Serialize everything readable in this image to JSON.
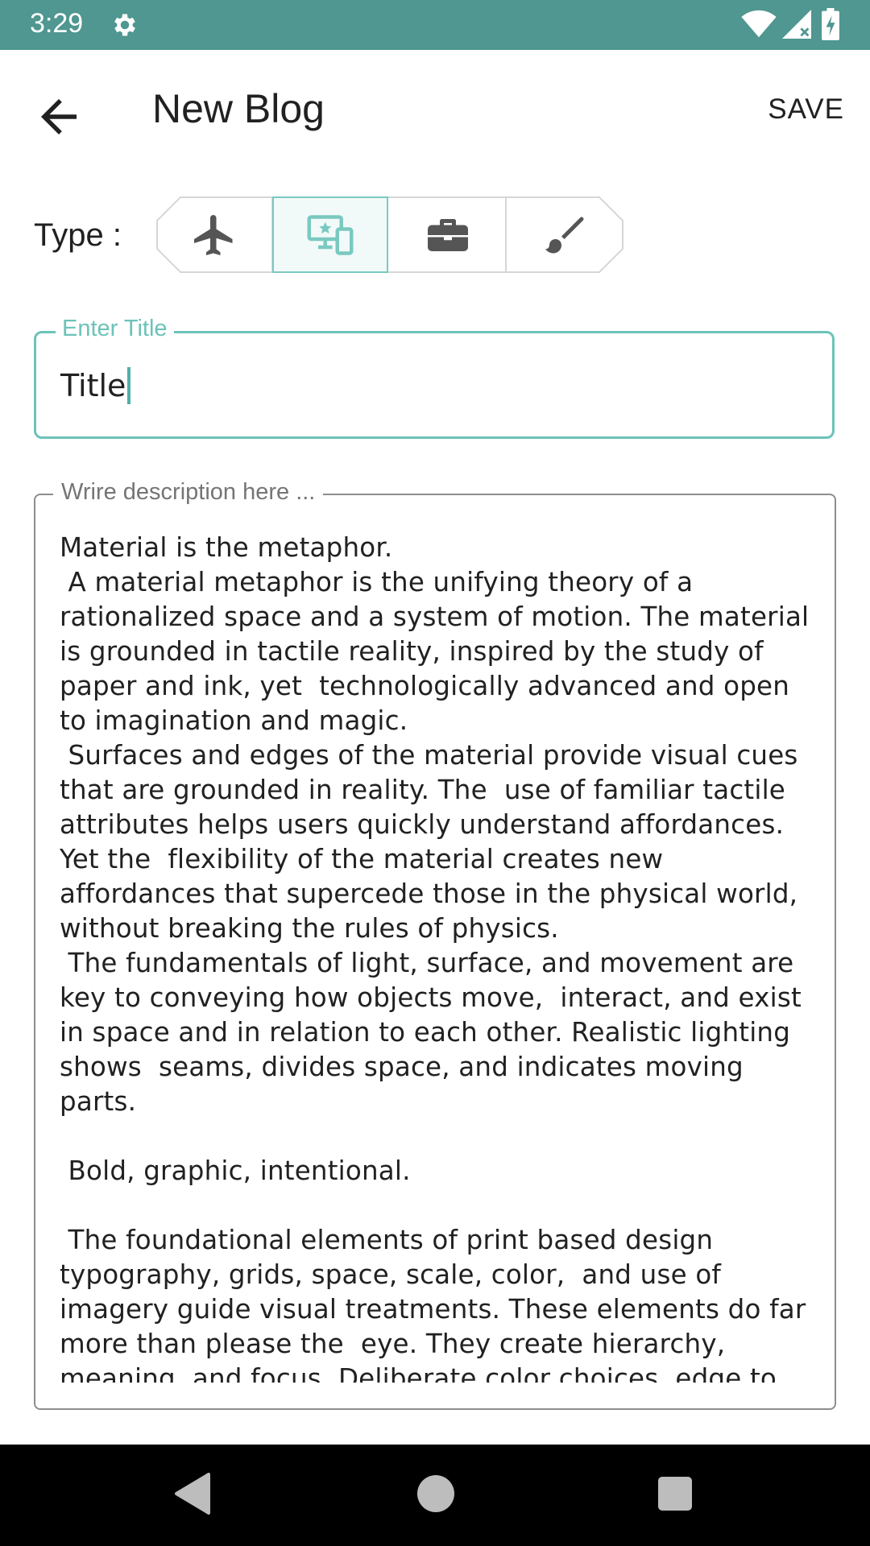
{
  "status_bar": {
    "time": "3:29",
    "icons": [
      "gear-icon",
      "wifi-icon",
      "signal-icon",
      "battery-icon"
    ]
  },
  "app_bar": {
    "back_icon": "arrow-left-icon",
    "title": "New Blog",
    "save_label": "SAVE"
  },
  "type_selector": {
    "label": "Type :",
    "options": [
      {
        "icon": "airplane-icon",
        "selected": false
      },
      {
        "icon": "devices-icon",
        "selected": true
      },
      {
        "icon": "briefcase-icon",
        "selected": false
      },
      {
        "icon": "brush-icon",
        "selected": false
      }
    ]
  },
  "title_field": {
    "label": "Enter Title",
    "value": "Title"
  },
  "description_field": {
    "label": "Wrire description here ...",
    "value": "Material is the metaphor.\n A material metaphor is the unifying theory of a rationalized space and a system of motion. The material is grounded in tactile reality, inspired by the study of paper and ink, yet  technologically advanced and open to imagination and magic.\n Surfaces and edges of the material provide visual cues that are grounded in reality. The  use of familiar tactile attributes helps users quickly understand affordances. Yet the  flexibility of the material creates new affordances that supercede those in the physical world, without breaking the rules of physics.\n The fundamentals of light, surface, and movement are key to conveying how objects move,  interact, and exist in space and in relation to each other. Realistic lighting shows  seams, divides space, and indicates moving parts.\n\n Bold, graphic, intentional.\n\n The foundational elements of print based design typography, grids, space, scale, color,  and use of imagery guide visual treatments. These elements do far more than please the  eye. They create hierarchy, meaning, and focus. Deliberate color choices, edge to"
  },
  "colors": {
    "status_bar": "#4f9790",
    "accent": "#6cc3b9",
    "nav_bar": "#000000"
  },
  "nav_bar": {
    "icons": [
      "nav-back-icon",
      "nav-home-icon",
      "nav-recents-icon"
    ]
  }
}
